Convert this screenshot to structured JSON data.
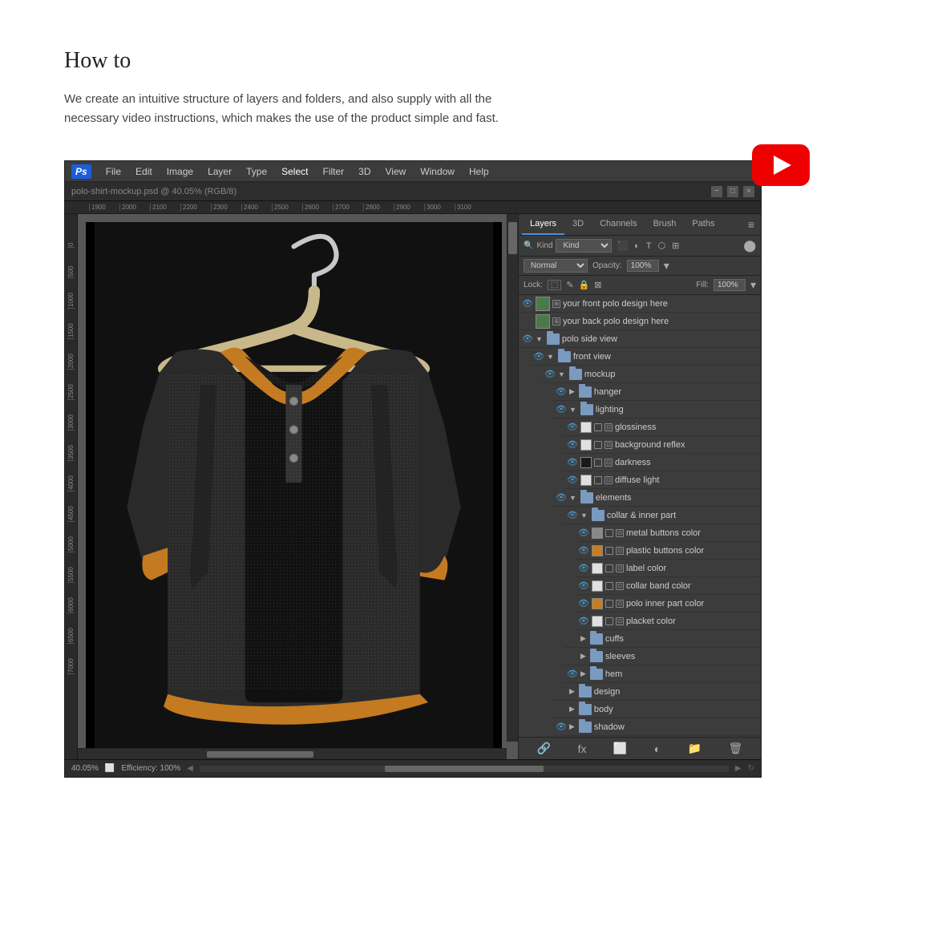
{
  "page": {
    "title": "How to",
    "description": "We create an intuitive structure of layers and folders, and also supply with all the necessary video instructions, which makes the use of the product simple and fast."
  },
  "photoshop": {
    "logo": "Ps",
    "menu_items": [
      "File",
      "Edit",
      "Image",
      "Layer",
      "Type",
      "Select",
      "Filter",
      "3D",
      "View",
      "Window",
      "Help"
    ],
    "zoom": "40.05%",
    "status": "Efficiency: 100%",
    "ruler_marks": [
      "1900",
      "2000",
      "2100",
      "2200",
      "2300",
      "2400",
      "2500",
      "2600",
      "2700",
      "2800",
      "2900",
      "3000",
      "3100"
    ]
  },
  "panels": {
    "tabs": [
      "Layers",
      "3D",
      "Channels",
      "Brush",
      "Paths"
    ],
    "active_tab": "Layers",
    "filter_label": "Kind",
    "blend_mode": "Normal",
    "opacity_label": "Opacity:",
    "opacity_value": "100%",
    "lock_label": "Lock:",
    "fill_label": "Fill:",
    "fill_value": "100%"
  },
  "layers": [
    {
      "id": 1,
      "name": "your front polo design here",
      "indent": 0,
      "type": "layer",
      "eye": true,
      "swatch": "green"
    },
    {
      "id": 2,
      "name": "your back polo design here",
      "indent": 0,
      "type": "layer",
      "eye": false,
      "swatch": "green"
    },
    {
      "id": 3,
      "name": "polo side view",
      "indent": 0,
      "type": "folder",
      "eye": true,
      "expanded": true
    },
    {
      "id": 4,
      "name": "front view",
      "indent": 1,
      "type": "folder",
      "eye": true,
      "expanded": true
    },
    {
      "id": 5,
      "name": "mockup",
      "indent": 2,
      "type": "folder",
      "eye": true,
      "expanded": true
    },
    {
      "id": 6,
      "name": "hanger",
      "indent": 3,
      "type": "folder",
      "eye": true,
      "expanded": false
    },
    {
      "id": 7,
      "name": "lighting",
      "indent": 3,
      "type": "folder",
      "eye": true,
      "expanded": true
    },
    {
      "id": 8,
      "name": "glossiness",
      "indent": 4,
      "type": "layer",
      "eye": true,
      "swatch": "white"
    },
    {
      "id": 9,
      "name": "background reflex",
      "indent": 4,
      "type": "layer",
      "eye": true,
      "swatch": "white"
    },
    {
      "id": 10,
      "name": "darkness",
      "indent": 4,
      "type": "layer",
      "eye": true,
      "swatch": "black"
    },
    {
      "id": 11,
      "name": "diffuse light",
      "indent": 4,
      "type": "layer",
      "eye": true,
      "swatch": "white"
    },
    {
      "id": 12,
      "name": "elements",
      "indent": 3,
      "type": "folder",
      "eye": true,
      "expanded": true
    },
    {
      "id": 13,
      "name": "collar & inner part",
      "indent": 4,
      "type": "folder",
      "eye": true,
      "expanded": true
    },
    {
      "id": 14,
      "name": "metal buttons color",
      "indent": 5,
      "type": "layer",
      "eye": true,
      "swatch": "gray"
    },
    {
      "id": 15,
      "name": "plastic buttons color",
      "indent": 5,
      "type": "layer",
      "eye": true,
      "swatch": "orange"
    },
    {
      "id": 16,
      "name": "label color",
      "indent": 5,
      "type": "layer",
      "eye": true,
      "swatch": "white"
    },
    {
      "id": 17,
      "name": "collar band color",
      "indent": 5,
      "type": "layer",
      "eye": true,
      "swatch": "white"
    },
    {
      "id": 18,
      "name": "polo inner part color",
      "indent": 5,
      "type": "layer",
      "eye": true,
      "swatch": "orange"
    },
    {
      "id": 19,
      "name": "placket color",
      "indent": 5,
      "type": "layer",
      "eye": true,
      "swatch": "white"
    },
    {
      "id": 20,
      "name": "cuffs",
      "indent": 4,
      "type": "folder",
      "eye": false,
      "expanded": false
    },
    {
      "id": 21,
      "name": "sleeves",
      "indent": 4,
      "type": "folder",
      "eye": false,
      "expanded": false
    },
    {
      "id": 22,
      "name": "hem",
      "indent": 4,
      "type": "folder",
      "eye": true,
      "expanded": false
    },
    {
      "id": 23,
      "name": "design",
      "indent": 3,
      "type": "folder",
      "eye": false,
      "expanded": false
    },
    {
      "id": 24,
      "name": "body",
      "indent": 3,
      "type": "folder",
      "eye": false,
      "expanded": false
    },
    {
      "id": 25,
      "name": "shadow",
      "indent": 3,
      "type": "folder",
      "eye": true,
      "expanded": false
    }
  ],
  "bottom_icons": [
    "link-icon",
    "fx-icon",
    "adjustment-icon",
    "mask-icon",
    "folder-icon",
    "delete-icon"
  ]
}
